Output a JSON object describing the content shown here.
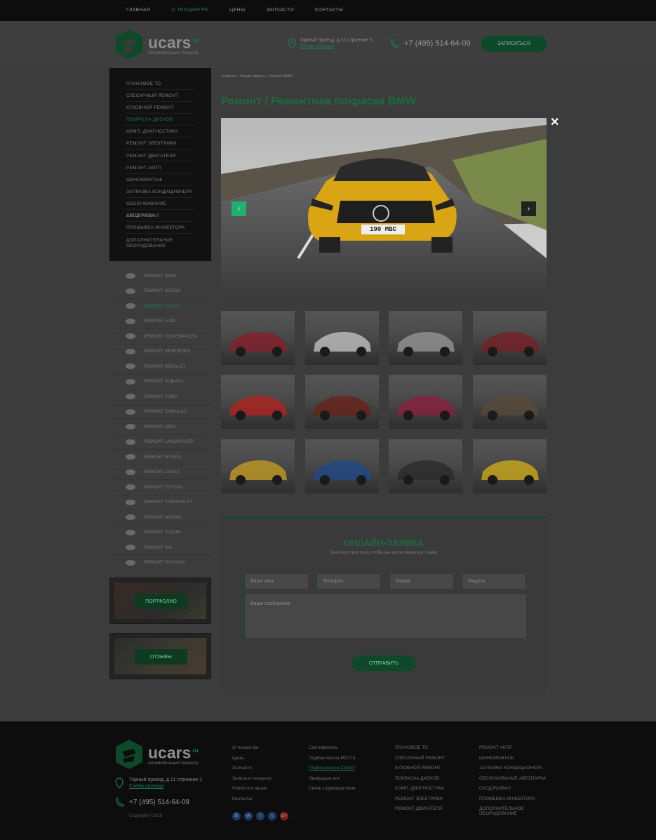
{
  "topnav": {
    "items": [
      {
        "label": "ГЛАВНАЯ",
        "active": false
      },
      {
        "label": "О ТЕХЦЕНТРЕ",
        "active": true
      },
      {
        "label": "ЦЕНЫ",
        "active": false
      },
      {
        "label": "ЗАПЧАСТИ",
        "active": false
      },
      {
        "label": "КОНТАКТЫ",
        "active": false
      }
    ]
  },
  "header": {
    "logo_name": "ucars",
    "logo_tld": ".ru",
    "logo_sub": "Автомобильный техцентр",
    "address": "Тарный проезд, д.11 строение 1",
    "address_link": "Схема проезда",
    "phone": "+7 (495) 514-64-09",
    "cta_label": "ЗАПИСАТЬСЯ"
  },
  "sidemenu": {
    "items": [
      {
        "label": "ПЛАНОВОЕ ТО",
        "active": false
      },
      {
        "label": "СЛЕСАРНЫЙ РЕМОНТ",
        "active": false
      },
      {
        "label": "КУЗОВНОЙ РЕМОНТ",
        "active": false
      },
      {
        "label": "ПОКРАСКА ДИСКОВ",
        "active": true
      },
      {
        "label": "КОМП. ДИАГНОСТИКА",
        "active": false
      },
      {
        "label": "РЕМОНТ ЭЛЕКТРИКИ",
        "active": false
      },
      {
        "label": "РЕМОНТ ДВИГАТЕЛЯ",
        "active": false
      },
      {
        "label": "РЕМОНТ АКПП",
        "active": false
      },
      {
        "label": "ШИНОМОНТАЖ",
        "active": false
      },
      {
        "label": "ЗАПРАВКА КОНДИЦИОНЕРА",
        "active": false
      },
      {
        "label": "ОБСЛУЖИВАНИЕ АВТОПАРКА",
        "active": false
      },
      {
        "label": "СХОД-РАЗВАЛ",
        "active": false
      },
      {
        "label": "ПРОМЫВКА ИНЖЕКТОРА",
        "active": false
      },
      {
        "label": "ДОПОЛНИТЕЛЬНОЕ ОБОРУДОВАНИЕ",
        "active": false
      }
    ]
  },
  "brands": {
    "items": [
      {
        "label": "РЕМОНТ BMW",
        "active": false
      },
      {
        "label": "РЕМОНТ MAZDA",
        "active": false
      },
      {
        "label": "РЕМОНТ SKODA",
        "active": true
      },
      {
        "label": "РЕМОНТ AUDI",
        "active": false
      },
      {
        "label": "РЕМОНТ VOLKSWAGEN",
        "active": false
      },
      {
        "label": "РЕМОНТ MERCEDES",
        "active": false
      },
      {
        "label": "РЕМОНТ RENAULT",
        "active": false
      },
      {
        "label": "РЕМОНТ SUBARU",
        "active": false
      },
      {
        "label": "РЕМОНТ FORD",
        "active": false
      },
      {
        "label": "РЕМОНТ CADILLAC",
        "active": false
      },
      {
        "label": "РЕМОНТ OPEL",
        "active": false
      },
      {
        "label": "РЕМОНТ LANDROVER",
        "active": false
      },
      {
        "label": "РЕМОНТ HONDA",
        "active": false
      },
      {
        "label": "РЕМОНТ LEXUS",
        "active": false
      },
      {
        "label": "РЕМОНТ TOYOTA",
        "active": false
      },
      {
        "label": "РЕМОНТ CHEVROLET",
        "active": false
      },
      {
        "label": "РЕМОНТ NISSAN",
        "active": false
      },
      {
        "label": "РЕМОНТ SUZUKI",
        "active": false
      },
      {
        "label": "РЕМОНТ KIA",
        "active": false
      },
      {
        "label": "РЕМОНТ HYUNDAI",
        "active": false
      }
    ]
  },
  "promos": {
    "portfolio": "ПОРТФОЛИО",
    "reviews": "ОТЗЫВЫ"
  },
  "breadcrumb": {
    "home": "Главная",
    "brands": "Марки машин",
    "current": "Ремонт BMW",
    "sep": " » "
  },
  "page_title": "Ремонт / Ремонтная покраска BMW",
  "hero": {
    "plate": "190 MBC"
  },
  "gallery": {
    "colors": [
      "#8a1d2a",
      "#c8c8c8",
      "#9a9a9a",
      "#7a1e24",
      "#b8201f",
      "#6a2015",
      "#8e1d3e",
      "#5a4a3a",
      "#c9a020",
      "#1e4a8a",
      "#2a2a2a",
      "#d4b018"
    ]
  },
  "form": {
    "title": "ОНЛАЙН-ЗАЯВКА",
    "subtitle": "Заполните все поля, чтобы мы могли связаться с вами",
    "name_placeholder": "Ваше имя",
    "phone_placeholder": "Телефон",
    "brand_placeholder": "Марка",
    "model_placeholder": "Модель",
    "message_placeholder": "Ваше сообщение",
    "submit": "ОТПРАВИТЬ"
  },
  "footer": {
    "address": "Тарный проезд, д.11 строение 1",
    "address_link": "Схема проезда",
    "phone": "+7 (495) 514-64-09",
    "copyright": "Copyright  ©  2018",
    "col1": [
      "О техцентре",
      "Цены",
      "Запчасти",
      "Запись в техцентр",
      "Новости и акции",
      "Контакты"
    ],
    "col2": [
      "Сертификаты",
      "Подбор масла MOTUL",
      "Подбор масла Castrol",
      "Эвакуация а/м",
      "Связь с руководством"
    ],
    "col2_active_index": 2,
    "col3": [
      "ПЛАНОВОЕ ТО",
      "СЛЕСАРНЫЙ РЕМОНТ",
      "КУЗОВНОЙ РЕМОНТ",
      "ПОКРАСКА ДИСКОВ",
      "КОМП. ДИАГНОСТИКА",
      "РЕМОНТ ЭЛЕКТРИКИ",
      "РЕМОНТ ДВИГАТЕЛЯ"
    ],
    "col4": [
      "РЕМОНТ АКПП",
      "ШИНОМОНТАЖ",
      "ЗАПРАВКА КОНДИЦИОНЕРА",
      "ОБСЛУЖИВАНИЕ АВТОПАРКА",
      "СХОД-РАЗВАЛ",
      "ПРОМЫВКА ИНЖЕКТОРА",
      "ДОПОЛНИТЕЛЬНОЕ ОБОРУДОВАНИЕ"
    ],
    "socials": [
      "В",
      "vk",
      "f",
      "t",
      "G+"
    ]
  },
  "colors": {
    "accent": "#1d7c4a",
    "accent_bright": "#21b070"
  }
}
